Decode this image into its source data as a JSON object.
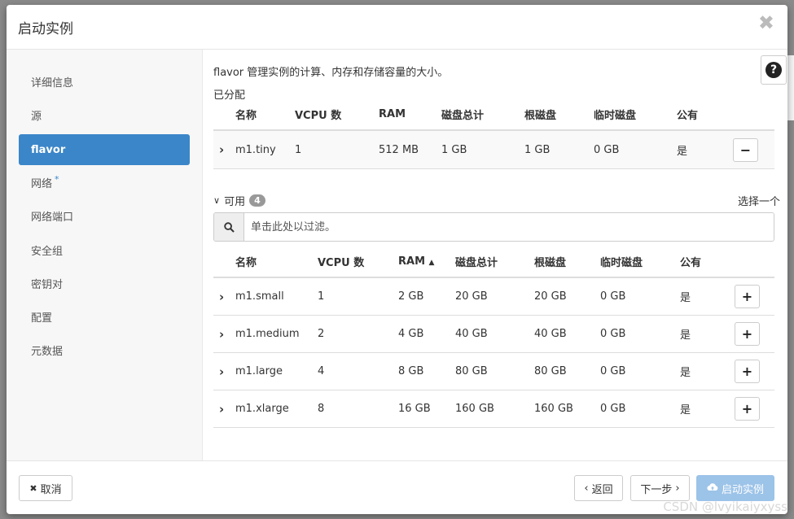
{
  "modal": {
    "title": "启动实例",
    "close_glyph": "✖"
  },
  "sidebar": {
    "items": [
      {
        "label": "详细信息"
      },
      {
        "label": "源"
      },
      {
        "label": "flavor",
        "active": true
      },
      {
        "label": "网络",
        "required_mark": "*"
      },
      {
        "label": "网络端口"
      },
      {
        "label": "安全组"
      },
      {
        "label": "密钥对"
      },
      {
        "label": "配置"
      },
      {
        "label": "元数据"
      }
    ]
  },
  "content": {
    "description": "flavor 管理实例的计算、内存和存储容量的大小。",
    "allocated": {
      "label": "已分配",
      "columns": [
        "名称",
        "VCPU 数",
        "RAM",
        "磁盘总计",
        "根磁盘",
        "临时磁盘",
        "公有"
      ],
      "rows": [
        {
          "name": "m1.tiny",
          "vcpu": "1",
          "ram": "512 MB",
          "disk_total": "1 GB",
          "root_disk": "1 GB",
          "ephemeral": "0 GB",
          "public": "是",
          "action": "−"
        }
      ]
    },
    "available": {
      "label": "可用",
      "count": "4",
      "choose_hint": "选择一个",
      "filter_placeholder": "单击此处以过滤。",
      "columns": [
        "名称",
        "VCPU 数",
        "RAM",
        "磁盘总计",
        "根磁盘",
        "临时磁盘",
        "公有"
      ],
      "sort_glyph": "▲",
      "rows": [
        {
          "name": "m1.small",
          "vcpu": "1",
          "ram": "2 GB",
          "disk_total": "20 GB",
          "root_disk": "20 GB",
          "ephemeral": "0 GB",
          "public": "是",
          "action": "+"
        },
        {
          "name": "m1.medium",
          "vcpu": "2",
          "ram": "4 GB",
          "disk_total": "40 GB",
          "root_disk": "40 GB",
          "ephemeral": "0 GB",
          "public": "是",
          "action": "+"
        },
        {
          "name": "m1.large",
          "vcpu": "4",
          "ram": "8 GB",
          "disk_total": "80 GB",
          "root_disk": "80 GB",
          "ephemeral": "0 GB",
          "public": "是",
          "action": "+"
        },
        {
          "name": "m1.xlarge",
          "vcpu": "8",
          "ram": "16 GB",
          "disk_total": "160 GB",
          "root_disk": "160 GB",
          "ephemeral": "0 GB",
          "public": "是",
          "action": "+"
        }
      ]
    }
  },
  "footer": {
    "cancel_label": "取消",
    "back_label": "返回",
    "next_label": "下一步",
    "launch_label": "启动实例"
  },
  "help_glyph": "?",
  "watermark": "CSDN @lvyikaiyxyss",
  "colors": {
    "accent": "#3b86c8",
    "launch_disabled": "#9cc3e8"
  }
}
